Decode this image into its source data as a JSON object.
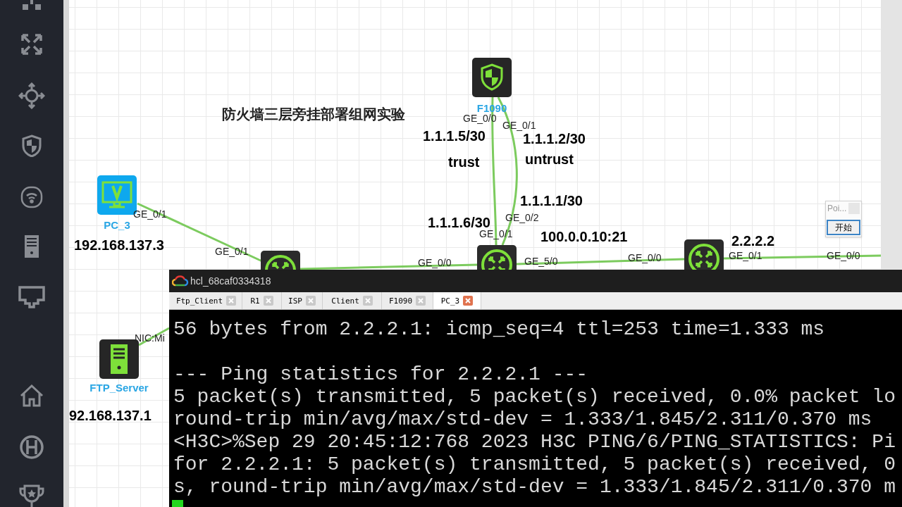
{
  "canvas": {
    "title": "防火墙三层旁挂部署组网实验",
    "devices": [
      {
        "kind": "firewall",
        "label": "F1090"
      },
      {
        "kind": "pc",
        "label": "PC_3",
        "address": "192.168.137.3"
      },
      {
        "kind": "server",
        "label": "FTP_Server",
        "address": "92.168.137.1"
      },
      {
        "kind": "router"
      },
      {
        "kind": "router"
      },
      {
        "kind": "router"
      }
    ],
    "labels": [
      {
        "kind": "port",
        "text": "GE_0/0"
      },
      {
        "kind": "port",
        "text": "GE_0/1"
      },
      {
        "kind": "address",
        "text": "1.1.1.5/30"
      },
      {
        "kind": "address",
        "text": "1.1.1.2/30"
      },
      {
        "kind": "address",
        "text": "trust"
      },
      {
        "kind": "address",
        "text": "untrust"
      },
      {
        "kind": "address",
        "text": "1.1.1.1/30"
      },
      {
        "kind": "address",
        "text": "1.1.1.6/30"
      },
      {
        "kind": "port",
        "text": "GE_0/2"
      },
      {
        "kind": "port",
        "text": "GE_0/1"
      },
      {
        "kind": "address",
        "text": "100.0.0.10:21"
      },
      {
        "kind": "address",
        "text": "2.2.2.2"
      },
      {
        "kind": "port",
        "text": "GE_0/1"
      },
      {
        "kind": "port",
        "text": "GE_0/1"
      },
      {
        "kind": "port",
        "text": "GE_0/0"
      },
      {
        "kind": "port",
        "text": "GE_5/0"
      },
      {
        "kind": "port",
        "text": "GE_0/0"
      },
      {
        "kind": "port",
        "text": "GE_0/1"
      },
      {
        "kind": "port",
        "text": "GE_0/0"
      },
      {
        "kind": "port",
        "text": "NIC:Mi"
      }
    ]
  },
  "popup": {
    "title": "Poi...",
    "button": "开始"
  },
  "terminal": {
    "title": "hcl_68caf0334318",
    "tabs": [
      {
        "label": "Ftp_Client",
        "selected": false
      },
      {
        "label": "R1",
        "selected": false
      },
      {
        "label": "ISP",
        "selected": false
      },
      {
        "label": "Client",
        "selected": false
      },
      {
        "label": "F1090",
        "selected": false
      },
      {
        "label": "PC_3",
        "selected": true
      }
    ],
    "blocks": [
      [
        "56 bytes from 2.2.2.1: icmp_seq=4 ttl=253 time=1.333 ms"
      ],
      [
        "--- Ping statistics for 2.2.2.1 ---",
        "5 packet(s) transmitted, 5 packet(s) received, 0.0% packet lo",
        "round-trip min/avg/max/std-dev = 1.333/1.845/2.311/0.370 ms",
        "<H3C>%Sep 29 20:45:12:768 2023 H3C PING/6/PING_STATISTICS: Pi",
        "for 2.2.2.1: 5 packet(s) transmitted, 5 packet(s) received, 0",
        "s, round-trip min/avg/max/std-dev = 1.333/1.845/2.311/0.370 m"
      ]
    ]
  }
}
